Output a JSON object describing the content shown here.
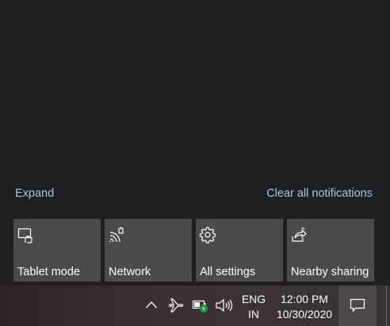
{
  "links": {
    "expand": "Expand",
    "clear_all": "Clear all notifications"
  },
  "quick_actions": [
    {
      "label": "Tablet mode",
      "icon": "tablet-mode-icon"
    },
    {
      "label": "Network",
      "icon": "network-icon"
    },
    {
      "label": "All settings",
      "icon": "gear-icon"
    },
    {
      "label": "Nearby sharing",
      "icon": "nearby-sharing-icon"
    }
  ],
  "taskbar": {
    "language_line1": "ENG",
    "language_line2": "IN",
    "time": "12:00 PM",
    "date": "10/30/2020",
    "icons": [
      "chevron-up-icon",
      "airplane-icon",
      "battery-icon",
      "volume-icon",
      "action-center-icon"
    ]
  },
  "colors": {
    "background": "#1f1f1f",
    "tile": "#4b4b4b",
    "link": "#9fc8f0",
    "battery_badge": "#1f9e3a"
  }
}
